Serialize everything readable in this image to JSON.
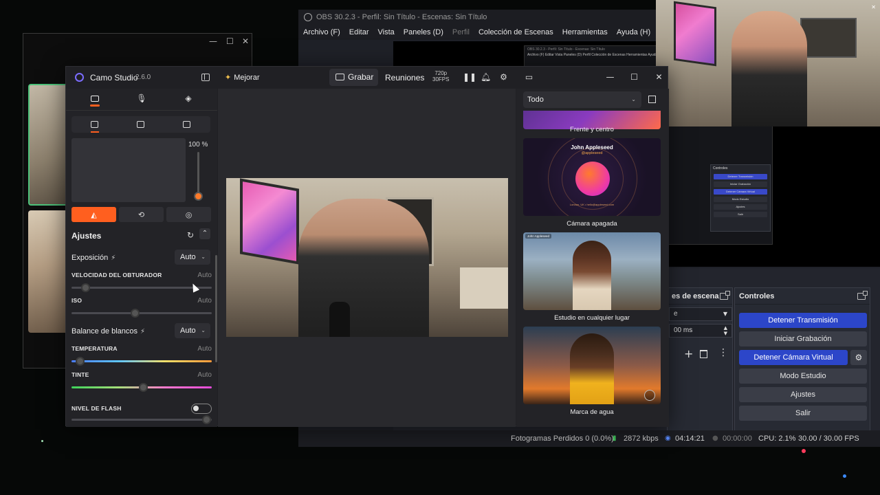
{
  "bg_window": {
    "min": "—",
    "max": "☐",
    "close": "✕"
  },
  "obs": {
    "title": "OBS 30.2.3 - Perfil: Sin Título - Escenas: Sin Título",
    "menu": [
      "Archivo (F)",
      "Editar",
      "Vista",
      "Paneles (D)",
      "Perfil",
      "Colección de Escenas",
      "Herramientas",
      "Ayuda (H)"
    ],
    "mini_title": "OBS 30.2.3 - Perfil: Sin Título - Escenas: Sin Título",
    "mini_menu": "Archivo (F)   Editar   Vista   Paneles (D)   Perfil   Colección de Escenas   Herramientas   Ayuda (H)",
    "mini_controls": {
      "title": "Controles",
      "buttons": [
        "Detener Transmisión",
        "Iniciar Grabación",
        "Detener Cámara Virtual",
        "Modo Estudio",
        "Ajustes",
        "Salir"
      ]
    },
    "scene_dock": {
      "title": "es de escena",
      "duration": "00 ms"
    },
    "controls": {
      "title": "Controles",
      "stop_stream": "Detener Transmisión",
      "start_record": "Iniciar Grabación",
      "stop_virtual_cam": "Detener Cámara Virtual",
      "studio_mode": "Modo Estudio",
      "settings": "Ajustes",
      "exit": "Salir"
    },
    "status": {
      "dropped_frames": "Fotogramas Perdidos 0 (0.0%)",
      "bitrate": "2872 kbps",
      "stream_time": "04:14:21",
      "record_time": "00:00:00",
      "cpu": "CPU: 2.1%",
      "fps": "30.00 / 30.00 FPS"
    }
  },
  "camo": {
    "app_name": "Camo Studio",
    "version": "2.6.0",
    "enhance_label": "Mejorar",
    "record_label": "Grabar",
    "meetings_label": "Reuniones",
    "resolution": "720p",
    "framerate": "30FPS",
    "zoom_value": "100 %",
    "settings": {
      "title": "Ajustes",
      "exposure_label": "Exposición",
      "exposure_value": "Auto",
      "shutter_label": "VELOCIDAD DEL OBTURADOR",
      "shutter_value": "Auto",
      "iso_label": "ISO",
      "iso_value": "Auto",
      "white_balance_label": "Balance de blancos",
      "white_balance_value": "Auto",
      "temperature_label": "TEMPERATURA",
      "temperature_value": "Auto",
      "tint_label": "TINTE",
      "tint_value": "Auto",
      "flash_label": "NIVEL DE FLASH"
    },
    "backgrounds": {
      "filter": "Todo",
      "items": [
        {
          "label": "Frente y centro"
        },
        {
          "label": "Cámara apagada",
          "card_name": "John Appleseed",
          "card_handle": "@appleseed",
          "card_footer": "London, UK • hello@appleseed.com"
        },
        {
          "label": "Estudio en cualquier lugar",
          "card_tag": "John Appleseed"
        },
        {
          "label": "Marca de agua"
        }
      ]
    }
  }
}
